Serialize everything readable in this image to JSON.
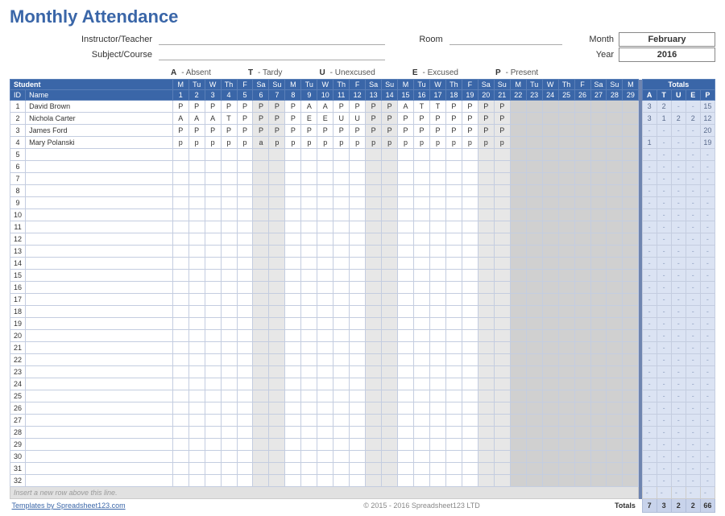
{
  "title": "Monthly Attendance",
  "meta": {
    "instructor_label": "Instructor/Teacher",
    "subject_label": "Subject/Course",
    "room_label": "Room",
    "month_label": "Month",
    "year_label": "Year",
    "month": "February",
    "year": "2016"
  },
  "legend": {
    "A": "- Absent",
    "T": "- Tardy",
    "U": "- Unexcused",
    "E": "- Excused",
    "P": "- Present"
  },
  "columns": {
    "student": "Student",
    "id": "ID",
    "name": "Name",
    "totals": "Totals",
    "tot_labels": [
      "A",
      "T",
      "U",
      "E",
      "P"
    ]
  },
  "days": {
    "dow": [
      "M",
      "Tu",
      "W",
      "Th",
      "F",
      "Sa",
      "Su",
      "M",
      "Tu",
      "W",
      "Th",
      "F",
      "Sa",
      "Su",
      "M",
      "Tu",
      "W",
      "Th",
      "F",
      "Sa",
      "Su",
      "M",
      "Tu",
      "W",
      "Th",
      "F",
      "Sa",
      "Su",
      "M"
    ],
    "num": [
      "1",
      "2",
      "3",
      "4",
      "5",
      "6",
      "7",
      "8",
      "9",
      "10",
      "11",
      "12",
      "13",
      "14",
      "15",
      "16",
      "17",
      "18",
      "19",
      "20",
      "21",
      "22",
      "23",
      "24",
      "25",
      "26",
      "27",
      "28",
      "29"
    ],
    "weekend_idx": [
      5,
      6,
      12,
      13,
      19,
      20,
      26,
      27
    ],
    "empty_after": 20
  },
  "students": [
    {
      "id": "1",
      "name": "David Brown",
      "marks": [
        "P",
        "P",
        "P",
        "P",
        "P",
        "P",
        "P",
        "P",
        "A",
        "A",
        "P",
        "P",
        "P",
        "P",
        "A",
        "T",
        "T",
        "P",
        "P",
        "P",
        "P"
      ],
      "tot": [
        "3",
        "2",
        "-",
        "-",
        "15"
      ]
    },
    {
      "id": "2",
      "name": "Nichola Carter",
      "marks": [
        "A",
        "A",
        "A",
        "T",
        "P",
        "P",
        "P",
        "P",
        "E",
        "E",
        "U",
        "U",
        "P",
        "P",
        "P",
        "P",
        "P",
        "P",
        "P",
        "P",
        "P"
      ],
      "tot": [
        "3",
        "1",
        "2",
        "2",
        "12"
      ]
    },
    {
      "id": "3",
      "name": "James Ford",
      "marks": [
        "P",
        "P",
        "P",
        "P",
        "P",
        "P",
        "P",
        "P",
        "P",
        "P",
        "P",
        "P",
        "P",
        "P",
        "P",
        "P",
        "P",
        "P",
        "P",
        "P",
        "P"
      ],
      "tot": [
        "-",
        "-",
        "-",
        "-",
        "20"
      ]
    },
    {
      "id": "4",
      "name": "Mary Polanski",
      "marks": [
        "p",
        "p",
        "p",
        "p",
        "p",
        "a",
        "p",
        "p",
        "p",
        "p",
        "p",
        "p",
        "p",
        "p",
        "p",
        "p",
        "p",
        "p",
        "p",
        "p",
        "p"
      ],
      "tot": [
        "1",
        "-",
        "-",
        "-",
        "19"
      ]
    }
  ],
  "empty_rows": [
    "5",
    "6",
    "7",
    "8",
    "9",
    "10",
    "11",
    "12",
    "13",
    "14",
    "15",
    "16",
    "17",
    "18",
    "19",
    "20",
    "21",
    "22",
    "23",
    "24",
    "25",
    "26",
    "27",
    "28",
    "29",
    "30",
    "31",
    "32"
  ],
  "insert_hint": "Insert a new row above this line.",
  "footer": {
    "link_text": "Templates by Spreadsheet123.com",
    "copyright": "© 2015 - 2016 Spreadsheet123 LTD",
    "totals_label": "Totals",
    "totals": [
      "7",
      "3",
      "2",
      "2",
      "66"
    ]
  }
}
